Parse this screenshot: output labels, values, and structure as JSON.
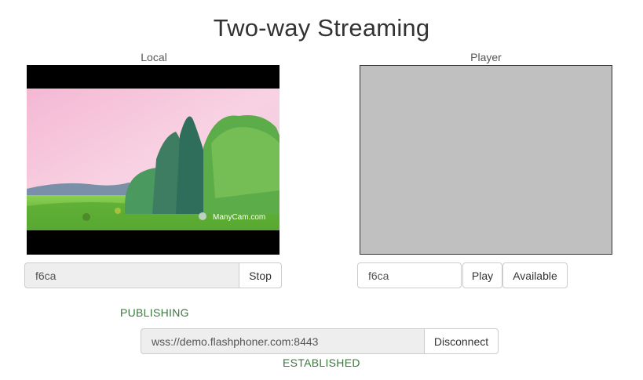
{
  "page": {
    "title": "Two-way Streaming"
  },
  "local": {
    "label": "Local",
    "watermark": "ManyCam.com",
    "stream_name": "f6ca",
    "stop_label": "Stop",
    "status": "PUBLISHING"
  },
  "player": {
    "label": "Player",
    "stream_name": "f6ca",
    "play_label": "Play",
    "available_label": "Available"
  },
  "connection": {
    "url": "wss://demo.flashphoner.com:8443",
    "disconnect_label": "Disconnect",
    "status": "ESTABLISHED"
  },
  "colors": {
    "status_green": "#3c763d",
    "player_bg": "#c0c0c0",
    "readonly_bg": "#eeeeee"
  }
}
